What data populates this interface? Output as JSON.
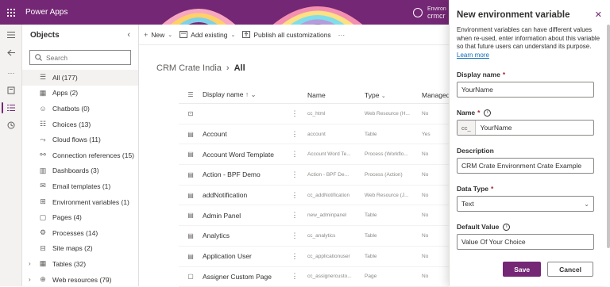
{
  "app": {
    "title": "Power Apps",
    "env_label": "Environ",
    "env_name": "crmcr"
  },
  "objects": {
    "title": "Objects",
    "search_placeholder": "Search",
    "items": [
      {
        "label": "All (177)",
        "icon": "list-icon",
        "selected": true,
        "expandable": false
      },
      {
        "label": "Apps (2)",
        "icon": "apps-icon",
        "expandable": false
      },
      {
        "label": "Chatbots (0)",
        "icon": "chatbot-icon",
        "expandable": false
      },
      {
        "label": "Choices (13)",
        "icon": "choices-icon",
        "expandable": false
      },
      {
        "label": "Cloud flows (11)",
        "icon": "flow-icon",
        "expandable": false
      },
      {
        "label": "Connection references (15)",
        "icon": "connection-icon",
        "expandable": false
      },
      {
        "label": "Dashboards (3)",
        "icon": "dashboard-icon",
        "expandable": false
      },
      {
        "label": "Email templates (1)",
        "icon": "email-icon",
        "expandable": false
      },
      {
        "label": "Environment variables (1)",
        "icon": "variable-icon",
        "expandable": false
      },
      {
        "label": "Pages (4)",
        "icon": "page-icon",
        "expandable": false
      },
      {
        "label": "Processes (14)",
        "icon": "process-icon",
        "expandable": false
      },
      {
        "label": "Site maps (2)",
        "icon": "sitemap-icon",
        "expandable": false
      },
      {
        "label": "Tables (32)",
        "icon": "table-icon",
        "expandable": true
      },
      {
        "label": "Web resources (79)",
        "icon": "web-icon",
        "expandable": true
      }
    ]
  },
  "cmdbar": {
    "new": "New",
    "add_existing": "Add existing",
    "publish": "Publish all customizations"
  },
  "breadcrumb": {
    "root": "CRM Crate India",
    "current": "All"
  },
  "table": {
    "headers": {
      "display_name": "Display name",
      "name": "Name",
      "type": "Type",
      "managed": "Managed"
    },
    "rows": [
      {
        "display_name": "",
        "name": "cc_html",
        "type": "Web Resource (H...",
        "managed": "No"
      },
      {
        "display_name": "Account",
        "name": "account",
        "type": "Table",
        "managed": "Yes"
      },
      {
        "display_name": "Account Word Template",
        "name": "Account Word Te...",
        "type": "Process (Workflo...",
        "managed": "No"
      },
      {
        "display_name": "Action - BPF Demo",
        "name": "Action - BPF De...",
        "type": "Process (Action)",
        "managed": "No"
      },
      {
        "display_name": "addNotification",
        "name": "cc_addNotification",
        "type": "Web Resource (J...",
        "managed": "No"
      },
      {
        "display_name": "Admin Panel",
        "name": "new_adminpanel",
        "type": "Table",
        "managed": "No"
      },
      {
        "display_name": "Analytics",
        "name": "cc_analytics",
        "type": "Table",
        "managed": "No"
      },
      {
        "display_name": "Application User",
        "name": "cc_applicationuser",
        "type": "Table",
        "managed": "No"
      },
      {
        "display_name": "Assigner Custom Page",
        "name": "cc_assignercusto...",
        "type": "Page",
        "managed": "No"
      }
    ]
  },
  "panel": {
    "title": "New environment variable",
    "description": "Environment variables can have different values when re-used, enter information about this variable so that future users can understand its purpose.",
    "learn_more": "Learn more",
    "display_name_label": "Display name",
    "display_name_value": "YourName",
    "name_label": "Name",
    "name_prefix": "cc_",
    "name_value": "YourName",
    "description_label": "Description",
    "description_value": "CRM Crate Environment Crate Example",
    "data_type_label": "Data Type",
    "data_type_value": "Text",
    "default_value_label": "Default Value",
    "default_value_value": "Value Of Your Choice",
    "save": "Save",
    "cancel": "Cancel"
  }
}
